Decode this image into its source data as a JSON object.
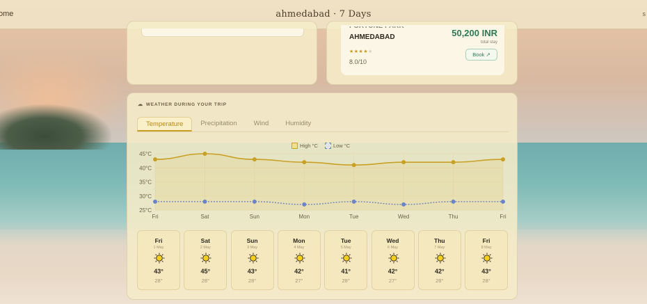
{
  "header": {
    "home_label": "ome",
    "title": "ahmedabad · 7 Days",
    "right_glyph": "s"
  },
  "hotel": {
    "name_line1": "FORTUNE PARK",
    "name_line2": "AHMEDABAD",
    "stars": 4,
    "stars_max": 5,
    "stars_filled": "★★★★",
    "stars_empty": "★",
    "rating": "8.0/10",
    "price": "50,200 INR",
    "price_note": "total stay",
    "book_label": "Book ↗"
  },
  "weather": {
    "section_title": "WEATHER DURING YOUR TRIP",
    "section_icon": "cloud-icon",
    "tabs": [
      {
        "label": "Temperature",
        "active": true
      },
      {
        "label": "Precipitation",
        "active": false
      },
      {
        "label": "Wind",
        "active": false
      },
      {
        "label": "Humidity",
        "active": false
      }
    ],
    "days": [
      {
        "name": "Fri",
        "date": "1 May",
        "high": "43°",
        "low": "28°",
        "icon": "sun-icon"
      },
      {
        "name": "Sat",
        "date": "2 May",
        "high": "45°",
        "low": "28°",
        "icon": "sun-icon"
      },
      {
        "name": "Sun",
        "date": "3 May",
        "high": "43°",
        "low": "28°",
        "icon": "sun-icon"
      },
      {
        "name": "Mon",
        "date": "4 May",
        "high": "42°",
        "low": "27°",
        "icon": "sun-icon"
      },
      {
        "name": "Tue",
        "date": "5 May",
        "high": "41°",
        "low": "28°",
        "icon": "sun-icon"
      },
      {
        "name": "Wed",
        "date": "6 May",
        "high": "42°",
        "low": "27°",
        "icon": "sun-icon"
      },
      {
        "name": "Thu",
        "date": "7 May",
        "high": "42°",
        "low": "28°",
        "icon": "sun-icon"
      },
      {
        "name": "Fri",
        "date": "8 May",
        "high": "43°",
        "low": "28°",
        "icon": "sun-icon"
      }
    ]
  },
  "chart_data": {
    "type": "line",
    "categories": [
      "Fri",
      "Sat",
      "Sun",
      "Mon",
      "Tue",
      "Wed",
      "Thu",
      "Fri"
    ],
    "series": [
      {
        "name": "High °C",
        "values": [
          43,
          45,
          43,
          42,
          41,
          42,
          42,
          43
        ],
        "color": "#c9a024"
      },
      {
        "name": "Low °C",
        "values": [
          28,
          28,
          28,
          27,
          28,
          27,
          28,
          28
        ],
        "color": "#6b84c9"
      }
    ],
    "y_ticks": [
      "25°C",
      "30°C",
      "35°C",
      "40°C",
      "45°C"
    ],
    "ylim": [
      25,
      45
    ],
    "legend": "top-center",
    "grid": true
  }
}
